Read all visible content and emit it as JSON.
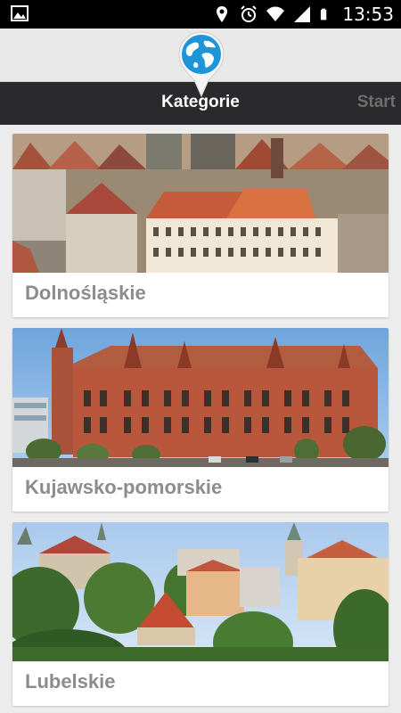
{
  "status_bar": {
    "time": "13:53",
    "icons": [
      "image-notification-icon",
      "location-icon",
      "alarm-icon",
      "wifi-icon",
      "signal-icon",
      "battery-icon"
    ]
  },
  "app_bar": {
    "title": "Kategorie",
    "right_action": "Start",
    "logo": "globe-pin-icon"
  },
  "categories": [
    {
      "label": "Dolnośląskie"
    },
    {
      "label": "Kujawsko-pomorskie"
    },
    {
      "label": "Lubelskie"
    }
  ],
  "colors": {
    "titlebar": "#2a2a2c",
    "logo_blue": "#1e95d9",
    "label_grey": "#8c8c8c",
    "background": "#ececec"
  }
}
